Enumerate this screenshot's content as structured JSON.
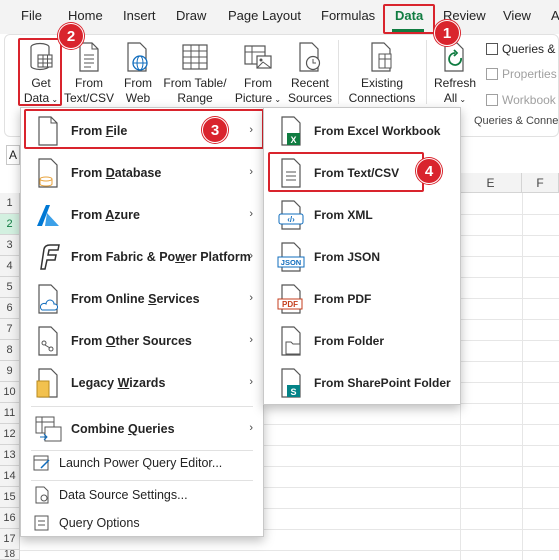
{
  "tabs": [
    "File",
    "Home",
    "Insert",
    "Draw",
    "Page Layout",
    "Formulas",
    "Data",
    "Review",
    "View",
    "A"
  ],
  "active_tab": "Data",
  "ribbon": {
    "get_data_line1": "Get",
    "get_data_line2": "Data",
    "from_text_csv": [
      "From",
      "Text/CSV"
    ],
    "from_web": [
      "From",
      "Web"
    ],
    "from_table_range": [
      "From Table/",
      "Range"
    ],
    "from_picture": [
      "From",
      "Picture"
    ],
    "recent_sources": [
      "Recent",
      "Sources"
    ],
    "existing_connections": [
      "Existing",
      "Connections"
    ],
    "refresh_all": [
      "Refresh",
      "All"
    ],
    "queries": "Queries &",
    "properties": "Properties",
    "workbook": "Workbook",
    "group_label": "Queries & Conne"
  },
  "grid": {
    "name_box": "A",
    "columns": [
      "E",
      "F"
    ],
    "rows": [
      "1",
      "2",
      "3",
      "4",
      "5",
      "6",
      "7",
      "8",
      "9",
      "10",
      "11",
      "12",
      "13",
      "14",
      "15",
      "16",
      "17",
      "18"
    ]
  },
  "menu_main": {
    "items": [
      {
        "label": "From File",
        "u": "F"
      },
      {
        "label": "From Database",
        "u": "D"
      },
      {
        "label": "From Azure",
        "u": "A"
      },
      {
        "label": "From Fabric & Power Platform",
        "u": "w"
      },
      {
        "label": "From Online Services",
        "u": "S"
      },
      {
        "label": "From Other Sources",
        "u": "O"
      },
      {
        "label": "Legacy Wizards",
        "u": "W"
      },
      {
        "label": "Combine Queries",
        "u": "Q"
      }
    ],
    "small_items": [
      "Launch Power Query Editor...",
      "Data Source Settings...",
      "Query Options"
    ]
  },
  "menu_sub": {
    "items": [
      "From Excel Workbook",
      "From Text/CSV",
      "From XML",
      "From JSON",
      "From PDF",
      "From Folder",
      "From SharePoint Folder"
    ]
  },
  "badges": [
    "1",
    "2",
    "3",
    "4"
  ],
  "colors": {
    "accent": "#107c41",
    "highlight": "#d9242d"
  }
}
